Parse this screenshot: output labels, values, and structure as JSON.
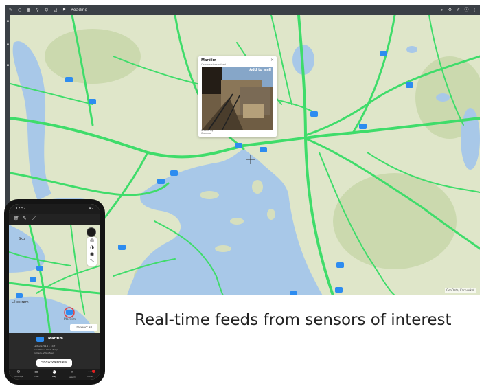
{
  "desktop": {
    "topbar": {
      "left_icons": [
        "wrench-icon",
        "circle-icon",
        "grid-icon",
        "pin-icon",
        "filter-icon",
        "ruler-icon",
        "flag-icon"
      ],
      "tab_label": "Roading",
      "right_icons": [
        "search-icon",
        "settings-icon",
        "edit-icon",
        "info-icon",
        "menu-icon"
      ]
    },
    "attribution": "GeoData, Kartverket"
  },
  "popup": {
    "title": "Martiim",
    "subtitle": "Camera stream feed",
    "add_label": "Add to wall",
    "footer_line1": "Shared by",
    "footer_line2": "Camera"
  },
  "phone": {
    "status": {
      "time": "12:57",
      "signal": "4G"
    },
    "map_labels": {
      "town_top": "Sku",
      "town_left": "Lillestrøm",
      "selected": "Maritim"
    },
    "deselect_label": "Deselect all",
    "panel": {
      "name": "Maritim",
      "lines": [
        "Latitude: 59.9 • 10.7",
        "Conditions: Wind, Temp",
        "Camera, Video feed"
      ],
      "button": "Show WebView"
    },
    "tabs": [
      {
        "icon": "settings-icon",
        "label": "Settings"
      },
      {
        "icon": "chat-icon",
        "label": "Chat"
      },
      {
        "icon": "map-icon",
        "label": "Map"
      },
      {
        "icon": "search-icon",
        "label": "Search"
      },
      {
        "icon": "more-icon",
        "label": "More"
      }
    ]
  },
  "caption": "Real-time feeds from sensors of interest",
  "colors": {
    "road": "#3fdc6a",
    "water": "#a8c8e8",
    "land": "#dfe6c9",
    "camera": "#2d8cf0"
  }
}
